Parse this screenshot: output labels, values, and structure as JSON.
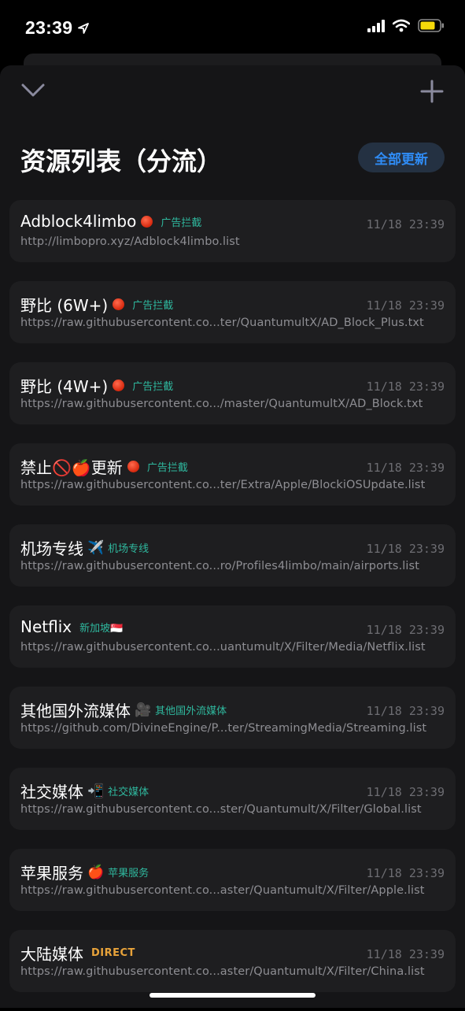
{
  "status_bar": {
    "time": "23:39",
    "location_icon": "location-arrow-icon",
    "signal_icon": "cellular-signal-icon",
    "wifi_icon": "wifi-icon",
    "battery_icon": "battery-icon",
    "battery_color": "#f5d90a"
  },
  "toolbar": {
    "collapse_icon": "chevron-down-icon",
    "add_icon": "plus-icon"
  },
  "header": {
    "title": "资源列表（分流）",
    "update_all_label": "全部更新"
  },
  "resources": [
    {
      "name": "Adblock4limbo",
      "emoji": "",
      "tag": "广告拦截",
      "tag_style": "red-dot",
      "date": "11/18 23:39",
      "url": "http://limbopro.xyz/Adblock4limbo.list"
    },
    {
      "name": "野比 (6W+)",
      "emoji": "",
      "tag": "广告拦截",
      "tag_style": "red-dot",
      "date": "11/18 23:39",
      "url": "https://raw.githubusercontent.co...ter/QuantumultX/AD_Block_Plus.txt"
    },
    {
      "name": "野比 (4W+)",
      "emoji": "",
      "tag": "广告拦截",
      "tag_style": "red-dot",
      "date": "11/18 23:39",
      "url": "https://raw.githubusercontent.co.../master/QuantumultX/AD_Block.txt"
    },
    {
      "name": "禁止🚫🍎更新",
      "emoji": "",
      "tag": "广告拦截",
      "tag_style": "red-dot",
      "date": "11/18 23:39",
      "url": "https://raw.githubusercontent.co...ter/Extra/Apple/BlockiOSUpdate.list"
    },
    {
      "name": "机场专线",
      "emoji": "✈️",
      "tag": "机场专线",
      "tag_style": "plain",
      "date": "11/18 23:39",
      "url": "https://raw.githubusercontent.co...ro/Profiles4limbo/main/airports.list"
    },
    {
      "name": "Netflix",
      "emoji": "",
      "tag": "新加坡🇸🇬",
      "tag_style": "plain",
      "date": "11/18 23:39",
      "url": "https://raw.githubusercontent.co...uantumult/X/Filter/Media/Netflix.list"
    },
    {
      "name": "其他国外流媒体",
      "emoji": "🎥",
      "tag": "其他国外流媒体",
      "tag_style": "plain",
      "date": "11/18 23:39",
      "url": "https://github.com/DivineEngine/P...ter/StreamingMedia/Streaming.list"
    },
    {
      "name": "社交媒体",
      "emoji": "📲",
      "tag": "社交媒体",
      "tag_style": "plain",
      "date": "11/18 23:39",
      "url": "https://raw.githubusercontent.co...ster/Quantumult/X/Filter/Global.list"
    },
    {
      "name": "苹果服务",
      "emoji": "🍎",
      "tag": "苹果服务",
      "tag_style": "plain",
      "date": "11/18 23:39",
      "url": "https://raw.githubusercontent.co...aster/Quantumult/X/Filter/Apple.list"
    },
    {
      "name": "大陆媒体",
      "emoji": "",
      "tag": "DIRECT",
      "tag_style": "direct",
      "date": "11/18 23:39",
      "url": "https://raw.githubusercontent.co...aster/Quantumult/X/Filter/China.list"
    }
  ],
  "colors": {
    "accent_blue": "#2f8cf6",
    "tag_green": "#2fb89e",
    "direct_orange": "#e8a33a"
  }
}
